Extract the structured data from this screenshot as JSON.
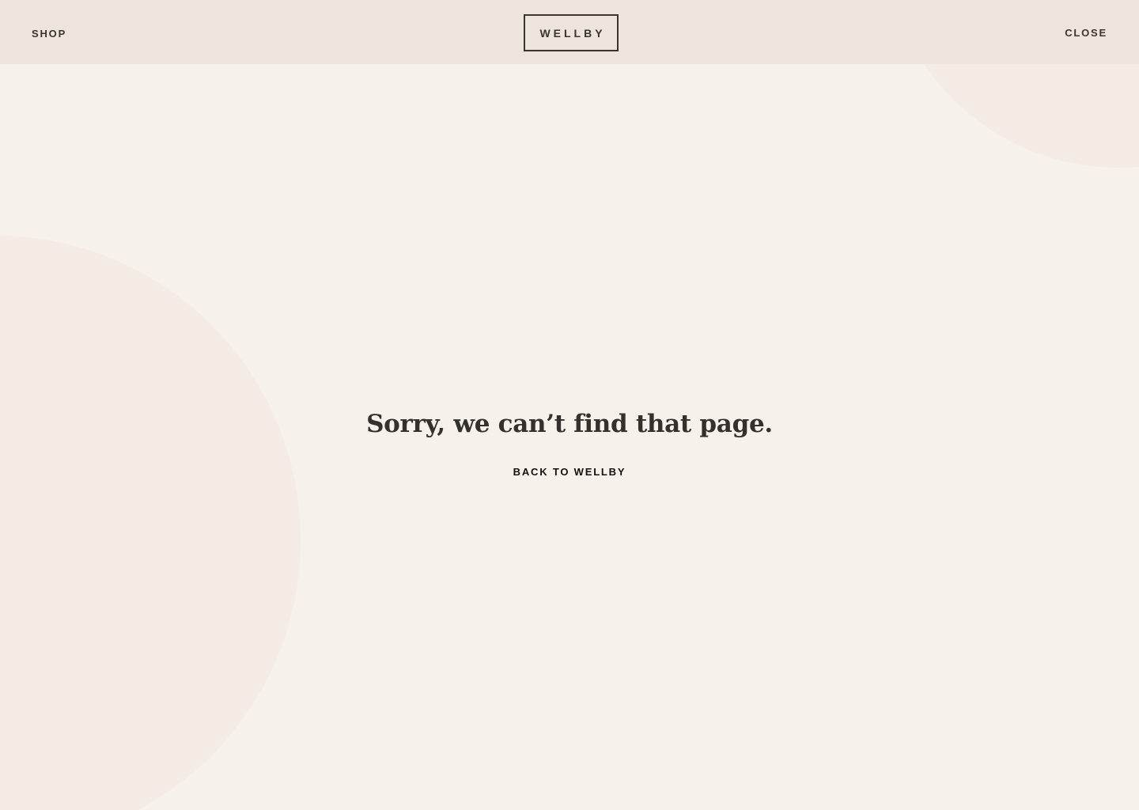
{
  "header": {
    "shop_label": "SHOP",
    "logo_text": "WELLBY",
    "close_label": "CLOSE"
  },
  "main": {
    "headline": "Sorry, we can’t find that page.",
    "back_link_label": "BACK TO WELLBY"
  },
  "colors": {
    "page_background": "#f6f1ea",
    "header_background": "#ede4db",
    "decorative_circle": "#f3ebe4",
    "text_dark": "#34302d"
  }
}
